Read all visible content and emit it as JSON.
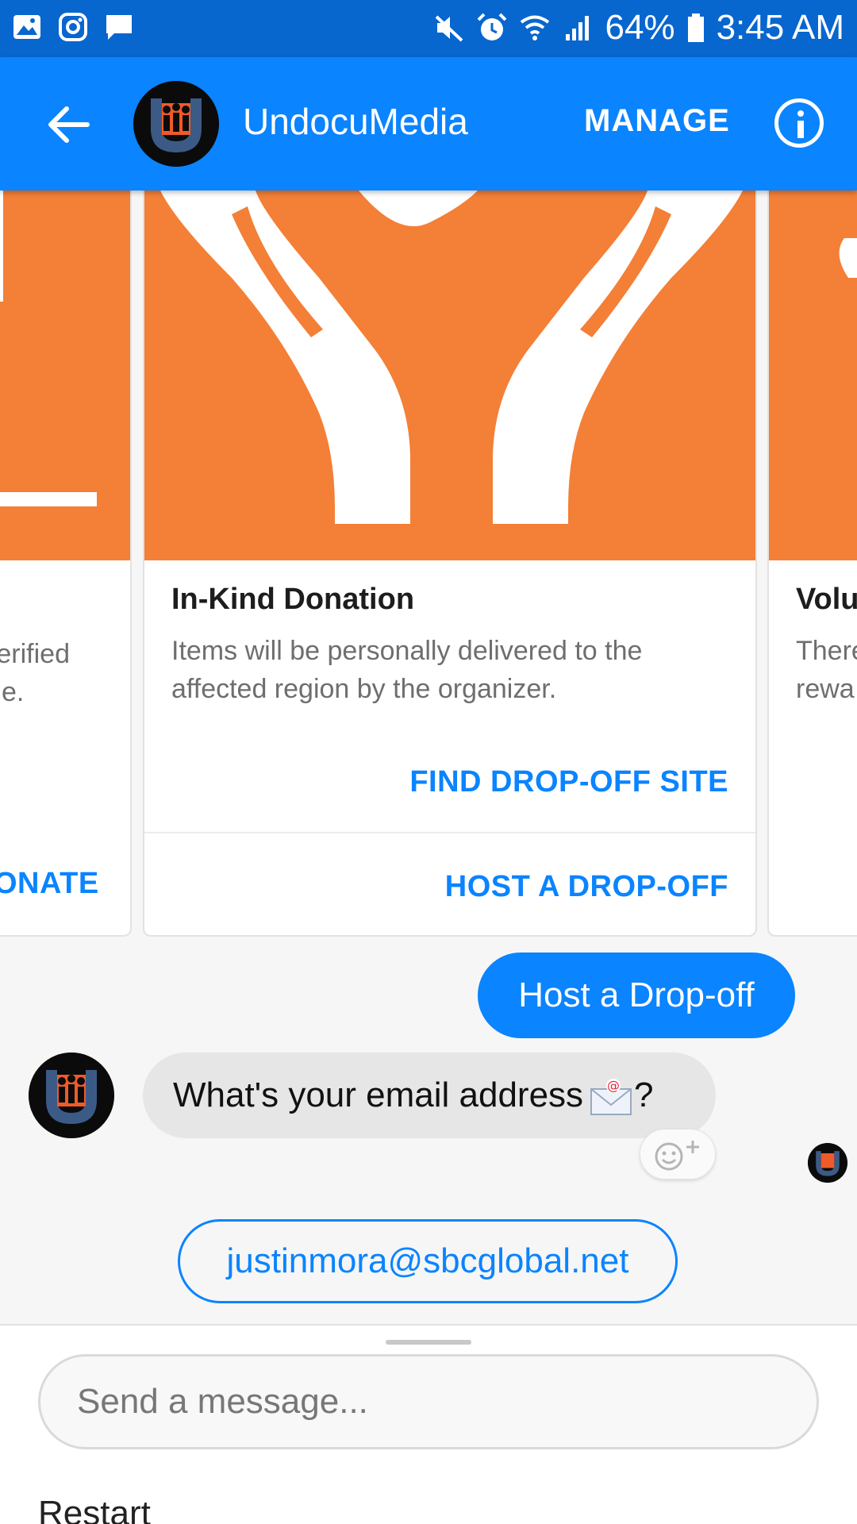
{
  "status_bar": {
    "battery": "64%",
    "time": "3:45 AM",
    "left_icons": [
      "gallery-icon",
      "instagram-icon",
      "message-icon"
    ],
    "right_icons": [
      "mute-icon",
      "alarm-icon",
      "wifi-icon",
      "signal-icon",
      "battery-icon"
    ]
  },
  "header": {
    "title": "UndocuMedia",
    "manage_label": "MANAGE",
    "back_icon": "arrow-left-icon",
    "info_icon": "info-icon"
  },
  "carousel": {
    "left_card": {
      "desc_line1": "erified",
      "desc_line2": "e.",
      "action": "ONATE"
    },
    "main_card": {
      "title": "In-Kind Donation",
      "desc_line1": "Items will be personally delivered to the",
      "desc_line2": "affected region by the organizer.",
      "action_primary": "FIND DROP-OFF SITE",
      "action_secondary": "HOST A DROP-OFF"
    },
    "right_card": {
      "title": "Volu",
      "desc_line1": "There",
      "desc_line2": "rewa"
    }
  },
  "messages": {
    "sent": "Host a Drop-off",
    "received": "What's your email address",
    "received_suffix": "?",
    "reaction_icon": "emoji-add-icon"
  },
  "quick_reply": "justinmora@sbcglobal.net",
  "composer": {
    "placeholder": "Send a message...",
    "restart_label": "Restart"
  },
  "colors": {
    "status_bar": "#0866cf",
    "app_bar": "#0a84ff",
    "accent": "#0a84ff",
    "card_image": "#f47f36"
  }
}
